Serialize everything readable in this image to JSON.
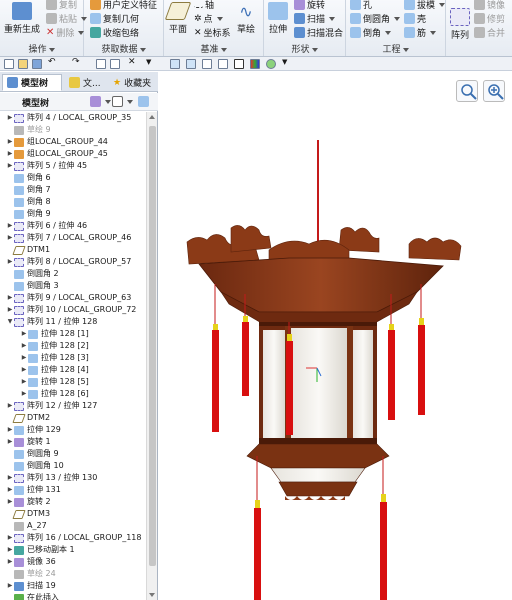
{
  "ribbon": {
    "groups": [
      {
        "label": "操作",
        "items": [
          {
            "label": "重新生成"
          },
          {
            "label": "复制",
            "disabled": true
          },
          {
            "label": "粘贴",
            "disabled": true
          },
          {
            "label": "删除",
            "disabled": true
          }
        ]
      },
      {
        "label": "获取数据",
        "items": [
          {
            "label": "用户定义特征"
          },
          {
            "label": "复制几何"
          },
          {
            "label": "收缩包络"
          }
        ]
      },
      {
        "label": "基准",
        "items": [
          {
            "label": "平面"
          },
          {
            "label": "轴"
          },
          {
            "label": "点"
          },
          {
            "label": "坐标系"
          },
          {
            "label": "草绘"
          }
        ]
      },
      {
        "label": "形状",
        "items": [
          {
            "label": "拉伸"
          },
          {
            "label": "旋转"
          },
          {
            "label": "扫描"
          },
          {
            "label": "扫描混合"
          }
        ]
      },
      {
        "label": "工程",
        "items": [
          {
            "label": "孔"
          },
          {
            "label": "倒圆角"
          },
          {
            "label": "倒角"
          },
          {
            "label": "拔模"
          },
          {
            "label": "壳"
          },
          {
            "label": "筋"
          }
        ]
      },
      {
        "label": "",
        "items": [
          {
            "label": "阵列"
          },
          {
            "label": "镜像",
            "disabled": true
          },
          {
            "label": "修剪",
            "disabled": true
          },
          {
            "label": "合并",
            "disabled": true
          }
        ]
      }
    ]
  },
  "left_panel": {
    "tabs": [
      {
        "label": "模型树",
        "icon": "tree-icon",
        "active": true
      },
      {
        "label": "文...",
        "icon": "folder-icon",
        "active": false
      },
      {
        "label": "收藏夹",
        "icon": "star-icon",
        "active": false
      }
    ],
    "tree_title": "模型树",
    "rows": [
      {
        "toggle": "▶",
        "icon": "pattern",
        "label": "阵列 4 / LOCAL_GROUP_35",
        "indent": 0
      },
      {
        "toggle": "",
        "icon": "sketch-gray",
        "label": "草绘 9",
        "indent": 0,
        "gray": true
      },
      {
        "toggle": "▶",
        "icon": "group",
        "label": "组LOCAL_GROUP_44",
        "indent": 0
      },
      {
        "toggle": "▶",
        "icon": "group",
        "label": "组LOCAL_GROUP_45",
        "indent": 0
      },
      {
        "toggle": "▶",
        "icon": "pattern",
        "label": "阵列 5 / 拉伸 45",
        "indent": 0
      },
      {
        "toggle": "",
        "icon": "round",
        "label": "倒角 6",
        "indent": 0
      },
      {
        "toggle": "",
        "icon": "round",
        "label": "倒角 7",
        "indent": 0
      },
      {
        "toggle": "",
        "icon": "round",
        "label": "倒角 8",
        "indent": 0
      },
      {
        "toggle": "",
        "icon": "round",
        "label": "倒角 9",
        "indent": 0
      },
      {
        "toggle": "▶",
        "icon": "pattern",
        "label": "阵列 6 / 拉伸 46",
        "indent": 0
      },
      {
        "toggle": "▶",
        "icon": "pattern",
        "label": "阵列 7 / LOCAL_GROUP_46",
        "indent": 0
      },
      {
        "toggle": "",
        "icon": "datum",
        "label": "DTM1",
        "indent": 0
      },
      {
        "toggle": "▶",
        "icon": "pattern",
        "label": "阵列 8 / LOCAL_GROUP_57",
        "indent": 0
      },
      {
        "toggle": "",
        "icon": "round",
        "label": "倒圆角 2",
        "indent": 0
      },
      {
        "toggle": "",
        "icon": "round",
        "label": "倒圆角 3",
        "indent": 0
      },
      {
        "toggle": "▶",
        "icon": "pattern",
        "label": "阵列 9 / LOCAL_GROUP_63",
        "indent": 0
      },
      {
        "toggle": "▶",
        "icon": "pattern",
        "label": "阵列 10 / LOCAL_GROUP_72",
        "indent": 0
      },
      {
        "toggle": "▼",
        "icon": "pattern",
        "label": "阵列 11 / 拉伸 128",
        "indent": 0
      },
      {
        "toggle": "▶",
        "icon": "extrude",
        "label": "拉伸 128 [1]",
        "indent": 1
      },
      {
        "toggle": "▶",
        "icon": "extrude",
        "label": "拉伸 128 [2]",
        "indent": 1
      },
      {
        "toggle": "▶",
        "icon": "extrude",
        "label": "拉伸 128 [3]",
        "indent": 1
      },
      {
        "toggle": "▶",
        "icon": "extrude",
        "label": "拉伸 128 [4]",
        "indent": 1
      },
      {
        "toggle": "▶",
        "icon": "extrude",
        "label": "拉伸 128 [5]",
        "indent": 1
      },
      {
        "toggle": "▶",
        "icon": "extrude",
        "label": "拉伸 128 [6]",
        "indent": 1
      },
      {
        "toggle": "▶",
        "icon": "pattern",
        "label": "阵列 12 / 拉伸 127",
        "indent": 0
      },
      {
        "toggle": "",
        "icon": "datum",
        "label": "DTM2",
        "indent": 0
      },
      {
        "toggle": "▶",
        "icon": "extrude",
        "label": "拉伸 129",
        "indent": 0
      },
      {
        "toggle": "▶",
        "icon": "revolve",
        "label": "旋转 1",
        "indent": 0
      },
      {
        "toggle": "",
        "icon": "round",
        "label": "倒圆角 9",
        "indent": 0
      },
      {
        "toggle": "",
        "icon": "round",
        "label": "倒圆角 10",
        "indent": 0
      },
      {
        "toggle": "▶",
        "icon": "pattern",
        "label": "阵列 13 / 拉伸 130",
        "indent": 0
      },
      {
        "toggle": "▶",
        "icon": "extrude",
        "label": "拉伸 131",
        "indent": 0
      },
      {
        "toggle": "▶",
        "icon": "revolve",
        "label": "旋转 2",
        "indent": 0
      },
      {
        "toggle": "",
        "icon": "datum",
        "label": "DTM3",
        "indent": 0
      },
      {
        "toggle": "",
        "icon": "axis",
        "label": "A_27",
        "indent": 0
      },
      {
        "toggle": "▶",
        "icon": "pattern",
        "label": "阵列 16 / LOCAL_GROUP_118",
        "indent": 0
      },
      {
        "toggle": "▶",
        "icon": "copy",
        "label": "已移动副本 1",
        "indent": 0
      },
      {
        "toggle": "▶",
        "icon": "mirror",
        "label": "镜像 36",
        "indent": 0
      },
      {
        "toggle": "",
        "icon": "sketch-gray",
        "label": "草绘 24",
        "indent": 0,
        "gray": true
      },
      {
        "toggle": "▶",
        "icon": "sweep",
        "label": "扫描 19",
        "indent": 0
      },
      {
        "toggle": "",
        "icon": "insert",
        "label": "在此插入",
        "indent": 0
      }
    ]
  },
  "graphics": {
    "toolbar_icons": [
      "zoom-fit-icon",
      "zoom-in-icon"
    ],
    "colors": {
      "wood": "#8b3a17",
      "wood_dark": "#5e230c",
      "tassel": "#d80f0f",
      "tassel_gold": "#e6d21a",
      "panel": "#f2f0ec"
    }
  }
}
